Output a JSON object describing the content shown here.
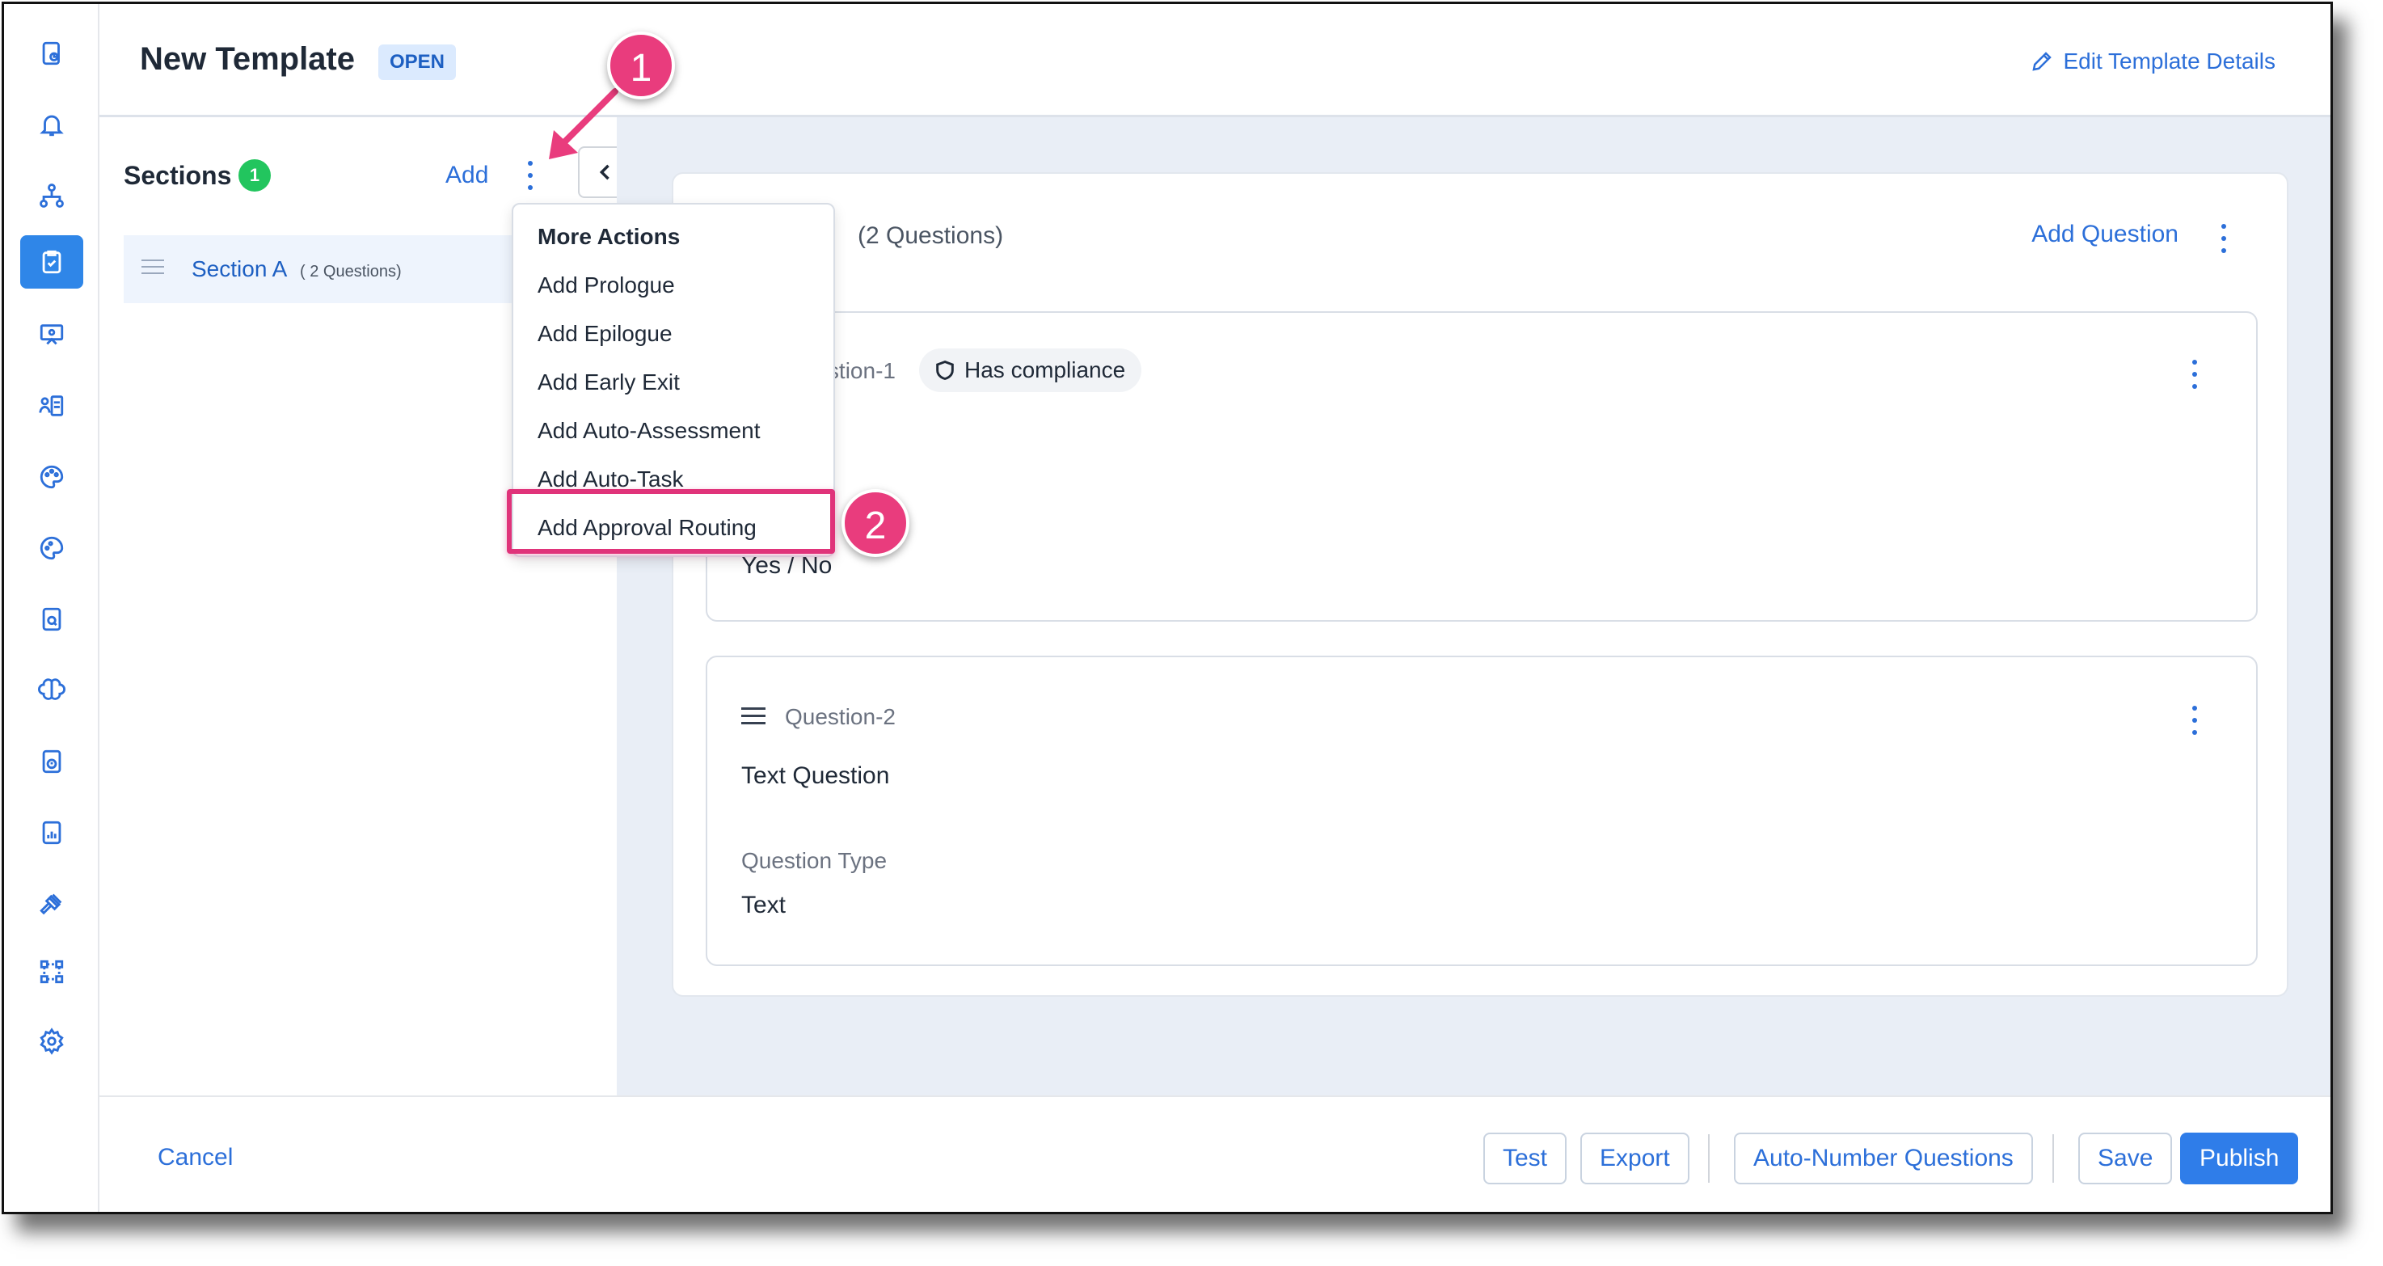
{
  "header": {
    "title": "New Template",
    "status_badge": "OPEN",
    "edit_details_label": "Edit Template Details"
  },
  "sections_panel": {
    "title": "Sections",
    "count": "1",
    "add_label": "Add",
    "items": [
      {
        "name": "Section A",
        "question_count": "( 2 Questions)"
      }
    ]
  },
  "section_card": {
    "question_count": "(2 Questions)",
    "add_question_label": "Add Question",
    "questions": [
      {
        "label": "Question-1",
        "compliance_label": "Has compliance",
        "text": "",
        "answer": "Yes / No"
      },
      {
        "label": "Question-2",
        "text": "Text Question",
        "type_label": "Question Type",
        "type_value": "Text"
      }
    ]
  },
  "more_actions_menu": {
    "header": "More Actions",
    "items": [
      "Add Prologue",
      "Add Epilogue",
      "Add Early Exit",
      "Add Auto-Assessment",
      "Add Auto-Task",
      "Add Approval Routing"
    ]
  },
  "callouts": [
    "1",
    "2"
  ],
  "footer": {
    "cancel_label": "Cancel",
    "buttons": [
      "Test",
      "Export",
      "Auto-Number Questions",
      "Save",
      "Publish"
    ]
  },
  "colors": {
    "accent": "#2c6fd9",
    "primary_button": "#2f7de9",
    "annotation": "#e93c7d",
    "success_badge": "#22c55e"
  },
  "rail_icons": [
    "dashboard-icon",
    "bell-icon",
    "hierarchy-icon",
    "checklist-icon",
    "presentation-icon",
    "user-list-icon",
    "palette-icon",
    "palette-alt-icon",
    "document-search-icon",
    "brain-icon",
    "document-alert-icon",
    "report-icon",
    "gavel-icon",
    "workflow-icon",
    "settings-icon"
  ]
}
